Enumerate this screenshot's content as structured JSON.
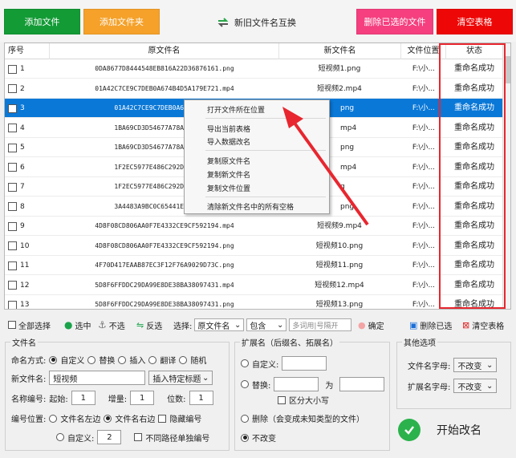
{
  "toolbar": {
    "add_file": "添加文件",
    "add_folder": "添加文件夹",
    "swap_names": "新旧文件名互换",
    "delete_selected": "删除已选的文件",
    "clear_table": "清空表格",
    "colors": {
      "add_file": "#139b36",
      "add_folder": "#f5a12a",
      "delete_selected": "#f53f7f",
      "clear_table": "#ee0707"
    }
  },
  "table": {
    "headers": [
      "序号",
      "原文件名",
      "新文件名",
      "文件位置",
      "状态"
    ],
    "rows": [
      {
        "no": "1",
        "original": "0DA8677D8444548EB816A22D36876161.png",
        "new": "短视频1.png",
        "location": "F:\\小...",
        "status": "重命名成功"
      },
      {
        "no": "2",
        "original": "01A42C7CE9C7DEB0A674B4D5A179E721.mp4",
        "new": "短视频2.mp4",
        "location": "F:\\小...",
        "status": "重命名成功"
      },
      {
        "no": "3",
        "original": "01A42C7CE9C7DEB0A674B4D5A1",
        "new": "png",
        "location": "F:\\小...",
        "status": "重命名成功"
      },
      {
        "no": "4",
        "original": "1BA69CD3D54677A78A16C20495",
        "new": "mp4",
        "location": "F:\\小...",
        "status": "重命名成功"
      },
      {
        "no": "5",
        "original": "1BA69CD3D54677A78A16C20495",
        "new": "png",
        "location": "F:\\小...",
        "status": "重命名成功"
      },
      {
        "no": "6",
        "original": "1F2EC5977E486C292D5F1F7D5E",
        "new": "mp4",
        "location": "F:\\小...",
        "status": "重命名成功"
      },
      {
        "no": "7",
        "original": "1F2EC5977E486C292D5F1F7D5E",
        "new": "g",
        "location": "F:\\小...",
        "status": "重命名成功"
      },
      {
        "no": "8",
        "original": "3A4483A9BC0C65441E148F4A84",
        "new": "png",
        "location": "F:\\小...",
        "status": "重命名成功"
      },
      {
        "no": "9",
        "original": "4D8F08CD806AA0F7E4332CE9CF592194.mp4",
        "new": "短视频9.mp4",
        "location": "F:\\小...",
        "status": "重命名成功"
      },
      {
        "no": "10",
        "original": "4D8F08CD806AA0F7E4332CE9CF592194.png",
        "new": "短视频10.png",
        "location": "F:\\小...",
        "status": "重命名成功"
      },
      {
        "no": "11",
        "original": "4F70D417EAAB87EC3F12F76A9029D73C.png",
        "new": "短视频11.png",
        "location": "F:\\小...",
        "status": "重命名成功"
      },
      {
        "no": "12",
        "original": "5D8F6FFDDC29DA99E8DE38BA38097431.mp4",
        "new": "短视频12.mp4",
        "location": "F:\\小...",
        "status": "重命名成功"
      },
      {
        "no": "13",
        "original": "5D8F6FFDDC29DA99E8DE38BA38097431.png",
        "new": "短视频13.png",
        "location": "F:\\小...",
        "status": "重命名成功"
      }
    ]
  },
  "context_menu": {
    "items": [
      "打开文件所在位置",
      "导出当前表格",
      "导入数据改名",
      "复制原文件名",
      "复制新文件名",
      "复制文件位置",
      "清除新文件名中的所有空格"
    ]
  },
  "bottom_bar": {
    "select_all": "全部选择",
    "check": "选中",
    "uncheck": "不选",
    "invert": "反选",
    "choose_label": "选择:",
    "field_select": "原文件名",
    "mode_select": "包含",
    "search_placeholder": "多词用|号隔开",
    "confirm": "确定",
    "delete_selected": "删除已选",
    "clear_table": "清空表格"
  },
  "filename_group": {
    "title": "文件名",
    "naming_mode_label": "命名方式:",
    "modes": [
      "自定义",
      "替换",
      "插入",
      "翻译",
      "随机"
    ],
    "new_name_label": "新文件名:",
    "new_name_value": "短视频",
    "insert_title": "插入特定标题",
    "numbering_label": "名称编号:",
    "start_label": "起始:",
    "start_value": "1",
    "step_label": "增量:",
    "step_value": "1",
    "digits_label": "位数:",
    "digits_value": "1",
    "position_label": "编号位置:",
    "pos_left": "文件名左边",
    "pos_right": "文件名右边",
    "hide_number": "隐藏编号",
    "pos_custom": "自定义:",
    "pos_custom_value": "2",
    "separate_path": "不同路径单独编号"
  },
  "ext_group": {
    "title": "扩展名（后缀名、拓展名）",
    "custom": "自定义:",
    "replace": "替换:",
    "to_label": "为",
    "case_sensitive": "区分大小写",
    "delete": "删除（会变成未知类型的文件）",
    "keep": "不改变"
  },
  "other_group": {
    "title": "其他选项",
    "name_case_label": "文件名字母:",
    "name_case_value": "不改变",
    "ext_case_label": "扩展名字母:",
    "ext_case_value": "不改变"
  },
  "start_button": "开始改名"
}
